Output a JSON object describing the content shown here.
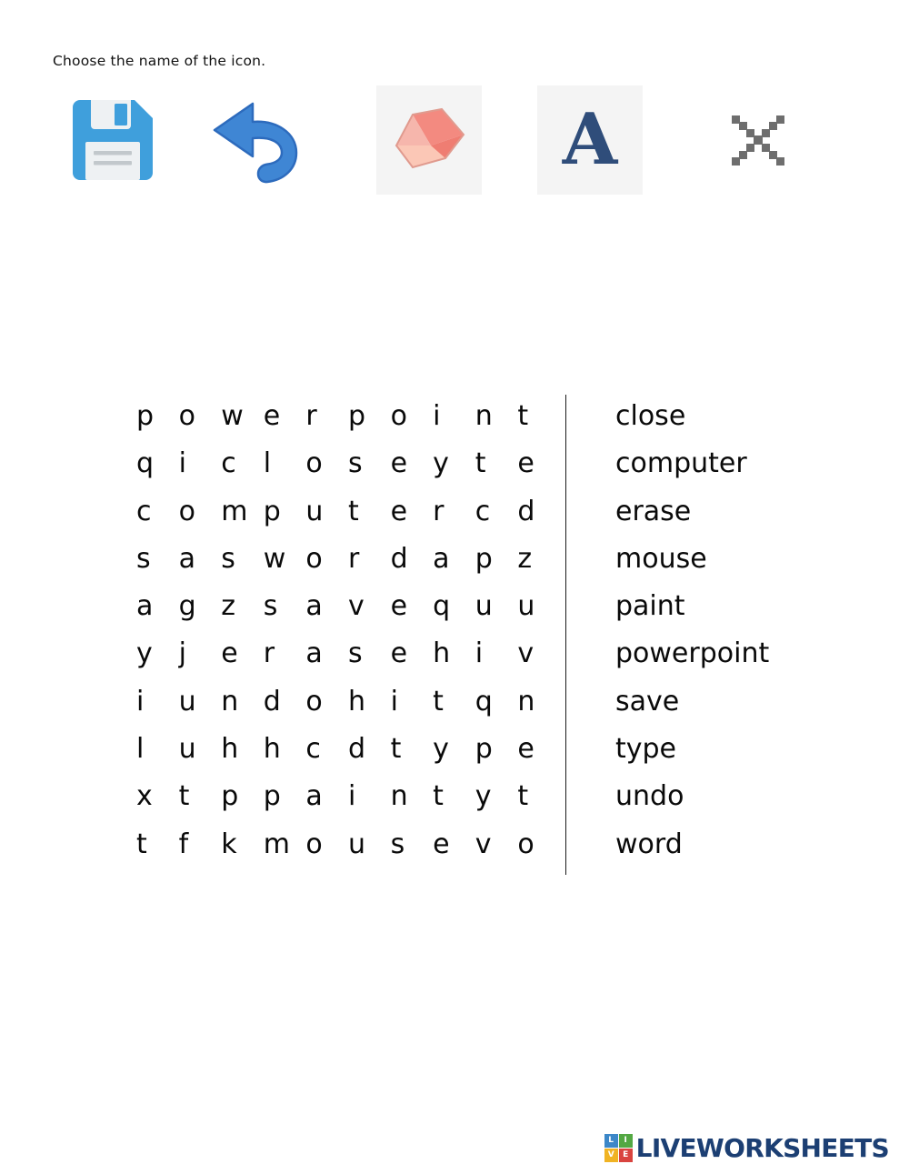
{
  "instruction": "Choose the name of the icon.",
  "icons": [
    {
      "name": "save-floppy-disk-icon",
      "label": "save",
      "boxed": false,
      "color": "#3f9fdc"
    },
    {
      "name": "undo-arrow-icon",
      "label": "undo",
      "boxed": false,
      "color": "#3a78cc"
    },
    {
      "name": "eraser-icon",
      "label": "erase",
      "boxed": true,
      "color": "#ef8a82"
    },
    {
      "name": "text-letter-a-icon",
      "label": "type",
      "boxed": true,
      "color": "#2f4d7a"
    },
    {
      "name": "close-x-icon",
      "label": "close",
      "boxed": false,
      "color": "#6e6e6e"
    }
  ],
  "puzzle": {
    "rows": [
      [
        "p",
        "o",
        "w",
        "e",
        "r",
        "p",
        "o",
        "i",
        "n",
        "t"
      ],
      [
        "q",
        "i",
        "c",
        "l",
        "o",
        "s",
        "e",
        "y",
        "t",
        "e"
      ],
      [
        "c",
        "o",
        "m",
        "p",
        "u",
        "t",
        "e",
        "r",
        "c",
        "d"
      ],
      [
        "s",
        "a",
        "s",
        "w",
        "o",
        "r",
        "d",
        "a",
        "p",
        "z"
      ],
      [
        "a",
        "g",
        "z",
        "s",
        "a",
        "v",
        "e",
        "q",
        "u",
        "u"
      ],
      [
        "y",
        "j",
        "e",
        "r",
        "a",
        "s",
        "e",
        "h",
        "i",
        "v"
      ],
      [
        "i",
        "u",
        "n",
        "d",
        "o",
        "h",
        "i",
        "t",
        "q",
        "n"
      ],
      [
        "l",
        "u",
        "h",
        "h",
        "c",
        "d",
        "t",
        "y",
        "p",
        "e"
      ],
      [
        "x",
        "t",
        "p",
        "p",
        "a",
        "i",
        "n",
        "t",
        "y",
        "t"
      ],
      [
        "t",
        "f",
        "k",
        "m",
        "o",
        "u",
        "s",
        "e",
        "v",
        "o"
      ]
    ],
    "words": [
      "close",
      "computer",
      "erase",
      "mouse",
      "paint",
      "powerpoint",
      "save",
      "type",
      "undo",
      "word"
    ]
  },
  "footer": {
    "logo_tiles": [
      {
        "letter": "L",
        "color": "#3c87c8"
      },
      {
        "letter": "I",
        "color": "#53a843"
      },
      {
        "letter": "V",
        "color": "#f0b323"
      },
      {
        "letter": "E",
        "color": "#d9443f"
      }
    ],
    "brand": "LIVEWORKSHEETS",
    "brand_color": "#1c3f73"
  }
}
